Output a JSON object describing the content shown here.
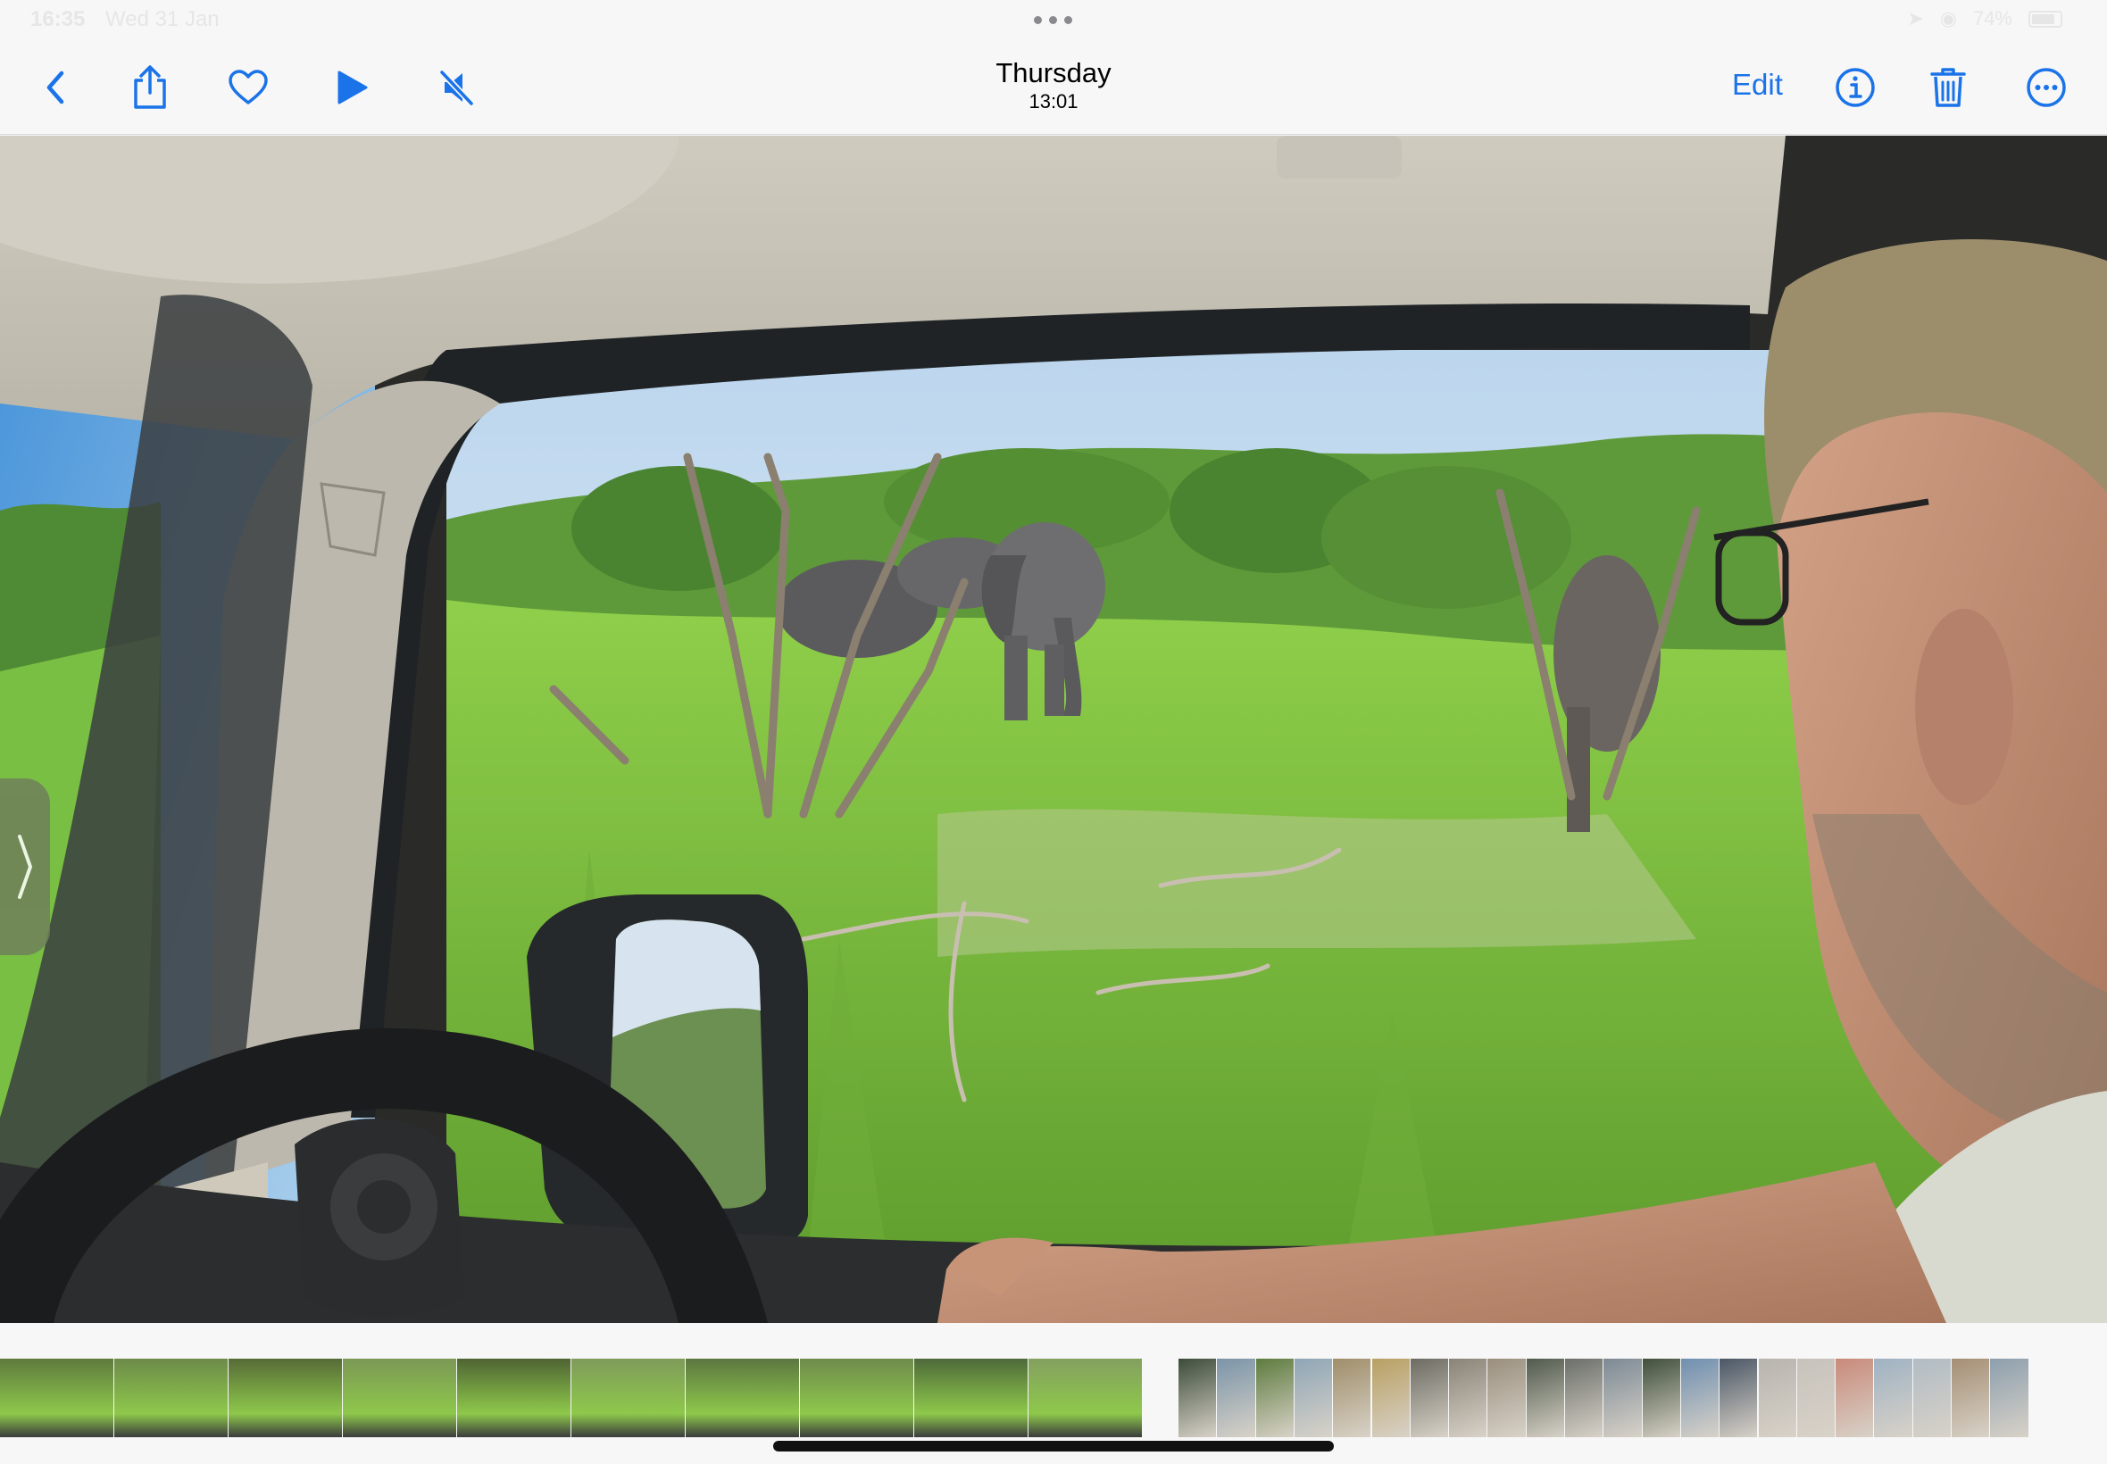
{
  "status_bar": {
    "time": "16:35",
    "date": "Wed 31 Jan",
    "battery": "74%"
  },
  "header": {
    "title": "Thursday",
    "subtitle": "13:01",
    "edit_label": "Edit"
  },
  "icons": {
    "back": "chevron-left-icon",
    "share": "share-icon",
    "favorite": "heart-icon",
    "play": "play-icon",
    "mute": "speaker-muted-icon",
    "info": "info-icon",
    "delete": "trash-icon",
    "more": "ellipsis-circle-icon"
  },
  "colors": {
    "accent": "#1a73e8",
    "background": "#f7f7f7"
  },
  "filmstrip": {
    "thumbnails": [
      {
        "tone": "#5f7a3e"
      },
      {
        "tone": "#6d8a4a"
      },
      {
        "tone": "#566b37"
      },
      {
        "tone": "#7b9855"
      },
      {
        "tone": "#4f6433"
      },
      {
        "tone": "#7f9b5a"
      },
      {
        "tone": "#5c7741"
      },
      {
        "tone": "#6f8b4c"
      },
      {
        "tone": "#4e6a3a"
      },
      {
        "tone": "#84a05f"
      },
      {
        "tone": "#3c4c3a"
      },
      {
        "tone": "#7a94a8"
      },
      {
        "tone": "#5e7c3f"
      },
      {
        "tone": "#8fa6b6"
      },
      {
        "tone": "#a08e6a"
      },
      {
        "tone": "#b9a063"
      },
      {
        "tone": "#6c6b62"
      },
      {
        "tone": "#8a8378"
      },
      {
        "tone": "#9a8f7e"
      },
      {
        "tone": "#505a4c"
      },
      {
        "tone": "#6b6f6a"
      },
      {
        "tone": "#7c8a95"
      },
      {
        "tone": "#3f4f3a"
      },
      {
        "tone": "#6f8fb0"
      },
      {
        "tone": "#4a5766"
      },
      {
        "tone": "#b8b4ae"
      },
      {
        "tone": "#c7c2bb"
      },
      {
        "tone": "#c98a7a"
      },
      {
        "tone": "#9fb2c3"
      },
      {
        "tone": "#b1bcc4"
      },
      {
        "tone": "#a58f74"
      },
      {
        "tone": "#8d9fae"
      }
    ]
  }
}
